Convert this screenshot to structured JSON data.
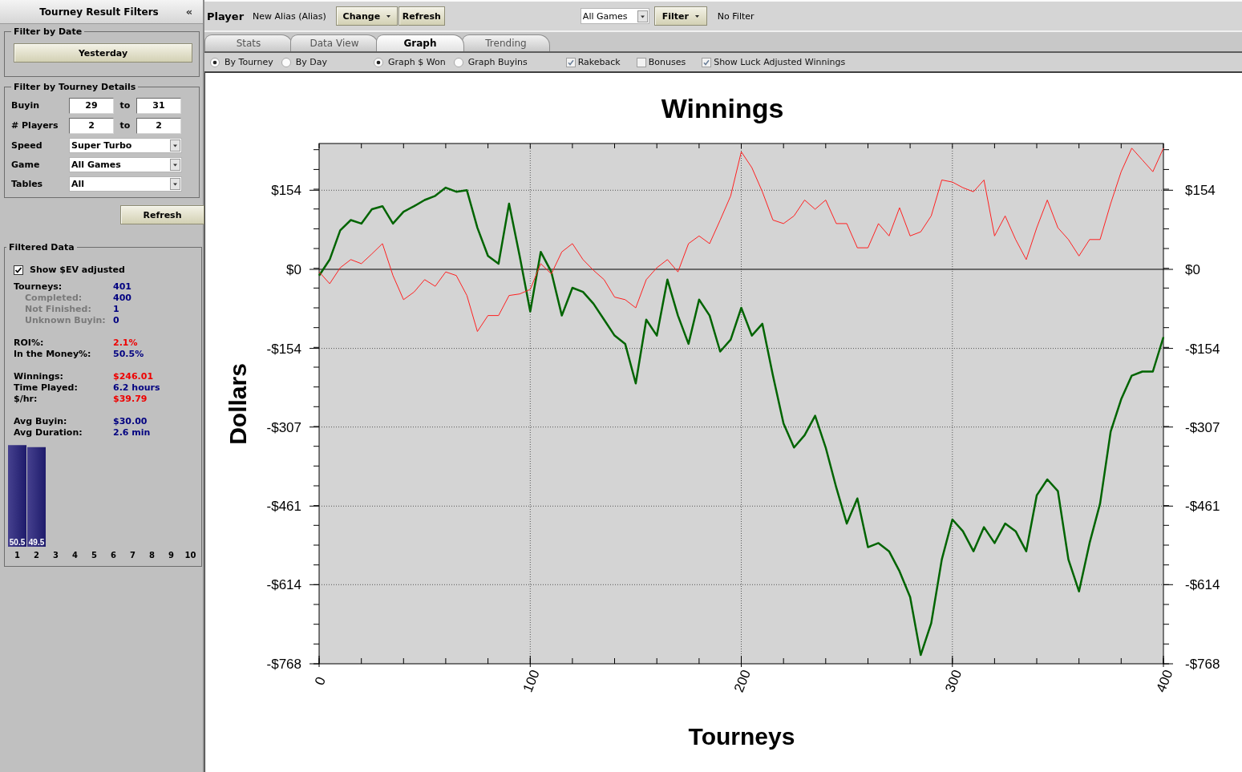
{
  "sidebar": {
    "title": "Tourney Result Filters",
    "collapse_button": "«",
    "date_filter": {
      "legend": "Filter by Date",
      "button": "Yesterday"
    },
    "details_filter": {
      "legend": "Filter by Tourney Details",
      "ranges": [
        {
          "label": "Buyin",
          "from": "29",
          "separator": "to",
          "to": "31"
        },
        {
          "label": "# Players",
          "from": "2",
          "separator": "to",
          "to": "2"
        }
      ],
      "selects": [
        {
          "label": "Speed",
          "value": "Super Turbo"
        },
        {
          "label": "Game",
          "value": "All Games"
        },
        {
          "label": "Tables",
          "value": "All"
        }
      ]
    },
    "refresh_button": "Refresh",
    "filtered_data": {
      "legend": "Filtered Data",
      "ev_checkbox": {
        "label": "Show $EV adjusted",
        "checked": true
      },
      "groups": [
        {
          "rows": [
            {
              "label": "Tourneys:",
              "value": "401",
              "color": "#000080",
              "children": [
                {
                  "label": "Completed:",
                  "value": "400",
                  "color": "#000080"
                },
                {
                  "label": "Not Finished:",
                  "value": "1",
                  "color": "#000080"
                },
                {
                  "label": "Unknown Buyin:",
                  "value": "0",
                  "color": "#000080"
                }
              ]
            }
          ]
        },
        {
          "rows": [
            {
              "label": "ROI%:",
              "value": "2.1%",
              "color": "#ee0000"
            },
            {
              "label": "In the Money%:",
              "value": "50.5%",
              "color": "#000080"
            }
          ]
        },
        {
          "rows": [
            {
              "label": "Winnings:",
              "value": "$246.01",
              "color": "#ee0000"
            },
            {
              "label": "Time Played:",
              "value": "6.2 hours",
              "color": "#000080"
            },
            {
              "label": "$/hr:",
              "value": "$39.79",
              "color": "#ee0000"
            }
          ]
        },
        {
          "rows": [
            {
              "label": "Avg Buyin:",
              "value": "$30.00",
              "color": "#000080"
            },
            {
              "label": "Avg Duration:",
              "value": "2.6 min",
              "color": "#000080"
            }
          ]
        }
      ],
      "histogram": {
        "chart_data": {
          "type": "bar",
          "categories": [
            "1",
            "2",
            "3",
            "4",
            "5",
            "6",
            "7",
            "8",
            "9",
            "10"
          ],
          "values": [
            50.5,
            49.5,
            0,
            0,
            0,
            0,
            0,
            0,
            0,
            0
          ],
          "ylim": [
            0,
            51
          ],
          "value_labels": [
            "50.5",
            "49.5",
            null,
            null,
            null,
            null,
            null,
            null,
            null,
            null
          ]
        }
      }
    }
  },
  "toolbar": {
    "player_label": "Player",
    "player_name": "New Alias (Alias)",
    "change_button": "Change",
    "refresh_button": "Refresh",
    "game_select": "All Games",
    "filter_button": "Filter",
    "filter_status": "No Filter"
  },
  "tabs": [
    {
      "label": "Stats",
      "selected": false
    },
    {
      "label": "Data View",
      "selected": false
    },
    {
      "label": "Graph",
      "selected": true
    },
    {
      "label": "Trending",
      "selected": false
    }
  ],
  "graph_options": {
    "group_by": [
      {
        "label": "By Tourney",
        "selected": true
      },
      {
        "label": "By Day",
        "selected": false
      }
    ],
    "graph_type": [
      {
        "label": "Graph $ Won",
        "selected": true
      },
      {
        "label": "Graph Buyins",
        "selected": false
      }
    ],
    "checkboxes": [
      {
        "label": "Rakeback",
        "checked": true
      },
      {
        "label": "Bonuses",
        "checked": false
      },
      {
        "label": "Show Luck Adjusted Winnings",
        "checked": true
      }
    ]
  },
  "graph": {
    "chart_data": {
      "type": "line",
      "title": "Winnings",
      "xlabel": "Tourneys",
      "ylabel": "Dollars",
      "x": [
        0,
        5,
        10,
        15,
        20,
        25,
        30,
        35,
        40,
        45,
        50,
        55,
        60,
        65,
        70,
        75,
        80,
        85,
        90,
        95,
        100,
        105,
        110,
        115,
        120,
        125,
        130,
        135,
        140,
        145,
        150,
        155,
        160,
        165,
        170,
        175,
        180,
        185,
        190,
        195,
        200,
        205,
        210,
        215,
        220,
        225,
        230,
        235,
        240,
        245,
        250,
        255,
        260,
        265,
        270,
        275,
        280,
        285,
        290,
        295,
        300,
        305,
        310,
        315,
        320,
        325,
        330,
        335,
        340,
        345,
        350,
        355,
        360,
        365,
        370,
        375,
        380,
        385,
        390,
        395,
        400
      ],
      "series": [
        {
          "color": "#006400",
          "values": [
            -12,
            19,
            76,
            96,
            89,
            117,
            123,
            89,
            112,
            123,
            135,
            143,
            159,
            151,
            154,
            81,
            26,
            11,
            128,
            26,
            -82,
            34,
            -5,
            -90,
            -36,
            -44,
            -67,
            -98,
            -129,
            -145,
            -222,
            -98,
            -129,
            -20,
            -90,
            -145,
            -59,
            -90,
            -160,
            -137,
            -75,
            -129,
            -106,
            -207,
            -300,
            -347,
            -323,
            -285,
            -347,
            -425,
            -495,
            -446,
            -541,
            -533,
            -549,
            -588,
            -638,
            -751,
            -689,
            -565,
            -487,
            -510,
            -549,
            -502,
            -533,
            -495,
            -510,
            -549,
            -440,
            -409,
            -432,
            -565,
            -627,
            -533,
            -456,
            -316,
            -253,
            -207,
            -199,
            -199,
            -132
          ]
        },
        {
          "color": "#ff2020",
          "values": [
            -5,
            -28,
            3,
            19,
            11,
            30,
            50,
            -12,
            -59,
            -44,
            -20,
            -33,
            -5,
            -12,
            -51,
            -121,
            -90,
            -90,
            -51,
            -48,
            -39,
            11,
            -9,
            34,
            50,
            19,
            -2,
            -20,
            -54,
            -59,
            -75,
            -20,
            3,
            19,
            -5,
            50,
            65,
            50,
            96,
            143,
            229,
            198,
            151,
            96,
            89,
            104,
            135,
            117,
            135,
            89,
            89,
            42,
            42,
            89,
            65,
            120,
            65,
            73,
            104,
            174,
            170,
            159,
            151,
            174,
            65,
            104,
            58,
            19,
            81,
            135,
            81,
            58,
            26,
            58,
            58,
            128,
            190,
            236,
            213,
            190,
            236
          ]
        }
      ],
      "xlim": [
        0,
        400
      ],
      "ylim": [
        -768,
        245
      ],
      "xticks": [
        0,
        100,
        200,
        300,
        400
      ],
      "yticks": [
        {
          "value": 154,
          "label": "$154"
        },
        {
          "value": 0,
          "label": "$0"
        },
        {
          "value": -154,
          "label": "-$154"
        },
        {
          "value": -307,
          "label": "-$307"
        },
        {
          "value": -461,
          "label": "-$461"
        },
        {
          "value": -614,
          "label": "-$614"
        },
        {
          "value": -768,
          "label": "-$768"
        }
      ],
      "grid": true
    }
  }
}
